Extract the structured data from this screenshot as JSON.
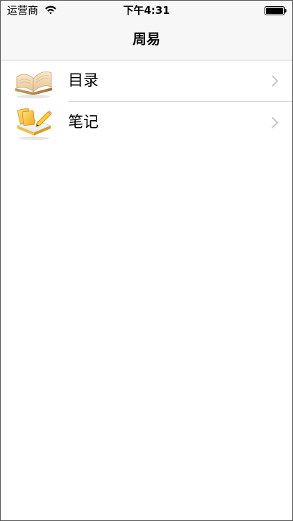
{
  "status_bar": {
    "carrier": "运营商",
    "time": "下午4:31",
    "icons": [
      "wifi-icon",
      "battery-icon"
    ]
  },
  "nav_bar": {
    "title": "周易"
  },
  "list": {
    "items": [
      {
        "label": "目录",
        "icon": "open-book-icon"
      },
      {
        "label": "笔记",
        "icon": "notes-pencil-icon"
      }
    ]
  },
  "colors": {
    "bar_background": "#f7f7f7",
    "separator": "#c8c7cc",
    "chevron": "#c7c7cc"
  }
}
